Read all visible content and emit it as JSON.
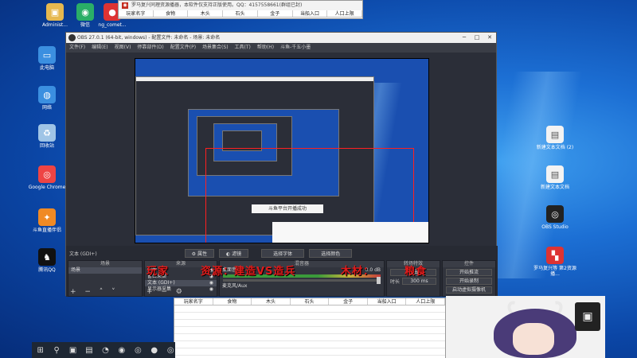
{
  "desktop_left": [
    {
      "label": "Administ...",
      "icon": "user-folder-icon",
      "color": "#e6b84f",
      "glyph": "▣"
    },
    {
      "label": "微信",
      "icon": "wechat-icon",
      "color": "#2aae67",
      "glyph": "◉"
    },
    {
      "label": "ng_comet...",
      "icon": "red-circle-app-icon",
      "color": "#d33",
      "glyph": "●"
    },
    {
      "label": "此电脑",
      "icon": "computer-icon",
      "color": "#3b8fe0",
      "glyph": "▭"
    },
    {
      "label": "网络",
      "icon": "network-icon",
      "color": "#3b8fe0",
      "glyph": "◍"
    },
    {
      "label": "回收站",
      "icon": "recycle-bin-icon",
      "color": "#9fc4e6",
      "glyph": "♻"
    },
    {
      "label": "Google Chrome",
      "icon": "chrome-icon",
      "color": "#e44",
      "glyph": "◎"
    },
    {
      "label": "斗鱼直播伴侣",
      "icon": "douyu-icon",
      "color": "#f08a24",
      "glyph": "✦"
    },
    {
      "label": "腾讯QQ",
      "icon": "qq-icon",
      "color": "#111",
      "glyph": "♞"
    }
  ],
  "desktop_right": [
    {
      "label": "新建文本文档 (2)",
      "icon": "text-document-icon",
      "color": "#f3f3f3",
      "glyph": "▤"
    },
    {
      "label": "新建文本文档",
      "icon": "text-document-icon",
      "color": "#f3f3f3",
      "glyph": "▤"
    },
    {
      "label": "OBS Studio",
      "icon": "obs-icon",
      "color": "#222",
      "glyph": "◎"
    },
    {
      "label": "罗马复兴等 第2资源播...",
      "icon": "red-app-icon",
      "color": "#d33",
      "glyph": "▚"
    }
  ],
  "top_sheet": {
    "title": "罗马复兴同理资源播器，本软件仅支持正版使用。QQ：4157558661(群组已封)",
    "columns": [
      "玩家名字",
      "食物",
      "木头",
      "石头",
      "金子",
      "当船入口",
      "人口上限"
    ]
  },
  "bottom_sheet": {
    "columns": [
      "玩家名字",
      "食物",
      "木头",
      "石头",
      "金子",
      "当船入口",
      "人口上限"
    ]
  },
  "obs": {
    "title": "OBS 27.0.1 (64-bit, windows) - 配置文件: 未命名 - 场景: 未命名",
    "menu": [
      "文件(F)",
      "编辑(E)",
      "视图(V)",
      "停靠部件(D)",
      "配置文件(P)",
      "场景集合(S)",
      "工具(T)",
      "帮助(H)",
      "斗鱼-千五小墨"
    ],
    "filter_left_label": "文本 (GDI+)",
    "buttons": {
      "properties": "属性",
      "filters": "滤镜",
      "select_text": "选择字体",
      "select_color": "选择颜色"
    },
    "docks": {
      "scenes": {
        "header": "场景",
        "items": [
          "场景"
        ]
      },
      "sources": {
        "header": "来源",
        "items": [
          "图像",
          "窗口采集",
          "文本 (GDI+)",
          "显示器采集"
        ]
      },
      "mixer": {
        "header": "混音器",
        "track1": "桌面音频",
        "track2": "麦克风/Aux",
        "level": "0.0 dB"
      },
      "transitions": {
        "header": "转场特效",
        "type": "淡出",
        "duration_label": "时长",
        "duration_value": "300 ms"
      },
      "controls": {
        "header": "控件",
        "items": [
          "开始推流",
          "开始录制",
          "启动虚拟摄像机"
        ]
      }
    },
    "inner_banner": "斗鱼平台开播成功"
  },
  "overlay": {
    "line1": "玩家",
    "line2": "资源：建造VS造兵",
    "line3": "木材：",
    "line4": "粮食"
  },
  "taskbar": [
    "start-icon",
    "search-icon",
    "task-view-icon",
    "file-explorer-icon",
    "edge-icon",
    "wechat-icon",
    "obs-taskbar-icon",
    "red-app-taskbar-icon",
    "chrome-taskbar-icon"
  ],
  "taskbar_glyphs": [
    "⊞",
    "⚲",
    "▣",
    "▤",
    "◔",
    "◉",
    "◎",
    "●",
    "◎"
  ]
}
